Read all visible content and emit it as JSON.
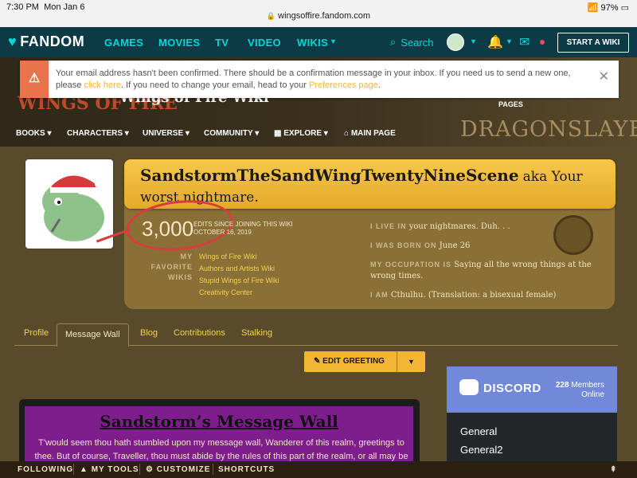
{
  "status": {
    "time": "7:30 PM",
    "date": "Mon Jan 6",
    "url": "wingsoffire.fandom.com",
    "battery": "97%"
  },
  "fandom_nav": {
    "logo": "FANDOM",
    "links": [
      "GAMES",
      "MOVIES",
      "TV",
      "VIDEO",
      "WIKIS"
    ],
    "search_label": "Search",
    "start_wiki": "START A WIKI"
  },
  "wiki_header": {
    "title": "Wings of Fire Wiki",
    "logo_text": "WINGS OF FIRE",
    "pages_label": "PAGES",
    "banner_art": "DRAGONSLAYER",
    "nav": [
      "BOOKS",
      "CHARACTERS",
      "UNIVERSE",
      "COMMUNITY",
      "EXPLORE",
      "MAIN PAGE"
    ]
  },
  "email_banner": {
    "text_a": "Your email address hasn't been confirmed. There should be a confirmation message in your inbox. If you need us to send a new one, please ",
    "link_a": "click here",
    "text_b": ". If you need to change your email, head to your ",
    "link_b": "Preferences page",
    "text_c": "."
  },
  "profile": {
    "username": "SandstormTheSandWingTwentyNineScene",
    "aka_a": "aka Your",
    "aka_b": "worst nightmare.",
    "edits": "3,000",
    "edits_label": "EDITS SINCE JOINING THIS WIKI",
    "edits_date": "OCTOBER 16, 2019",
    "favorite_label": "MY FAVORITE WIKIS",
    "favorite_wikis": [
      "Wings of Fire Wiki",
      "Authors and Artists Wiki",
      "Stupid Wings of Fire Wiki",
      "Creativity Center"
    ],
    "info": {
      "live_key": "I LIVE IN",
      "live_val": "your nightmares. Duh. . .",
      "born_key": "I WAS BORN ON",
      "born_val": "June 26",
      "occ_key": "MY OCCUPATION IS",
      "occ_val": "Saying all the wrong things at the wrong times.",
      "am_key": "I AM",
      "am_val": "Cthulhu. (Translation: a bisexual female)"
    }
  },
  "tabs": [
    "Profile",
    "Message Wall",
    "Blog",
    "Contributions",
    "Stalking"
  ],
  "edit_greeting": "EDIT GREETING",
  "wall": {
    "title": "Sandstorm’s Message Wall",
    "text": "T'would seem thou hath stumbled upon my message wall, Wanderer of this realm, greetings to thee. But of course, Traveller, thou must abide by the rules of this part of the realm, or all may be lost."
  },
  "discord": {
    "brand": "DISCORD",
    "members": "228",
    "members_label": "Members",
    "online_label": "Online",
    "channels": [
      "General",
      "General2"
    ]
  },
  "toolbar": {
    "following": "FOLLOWING",
    "my_tools": "MY TOOLS",
    "customize": "CUSTOMIZE",
    "shortcuts": "SHORTCUTS"
  },
  "colors": {
    "fandom_nav": "#0c3b46",
    "accent_teal": "#00d6d6",
    "gold": "#f2b634",
    "wall_purple": "#7e1e8c",
    "discord": "#7289da"
  }
}
